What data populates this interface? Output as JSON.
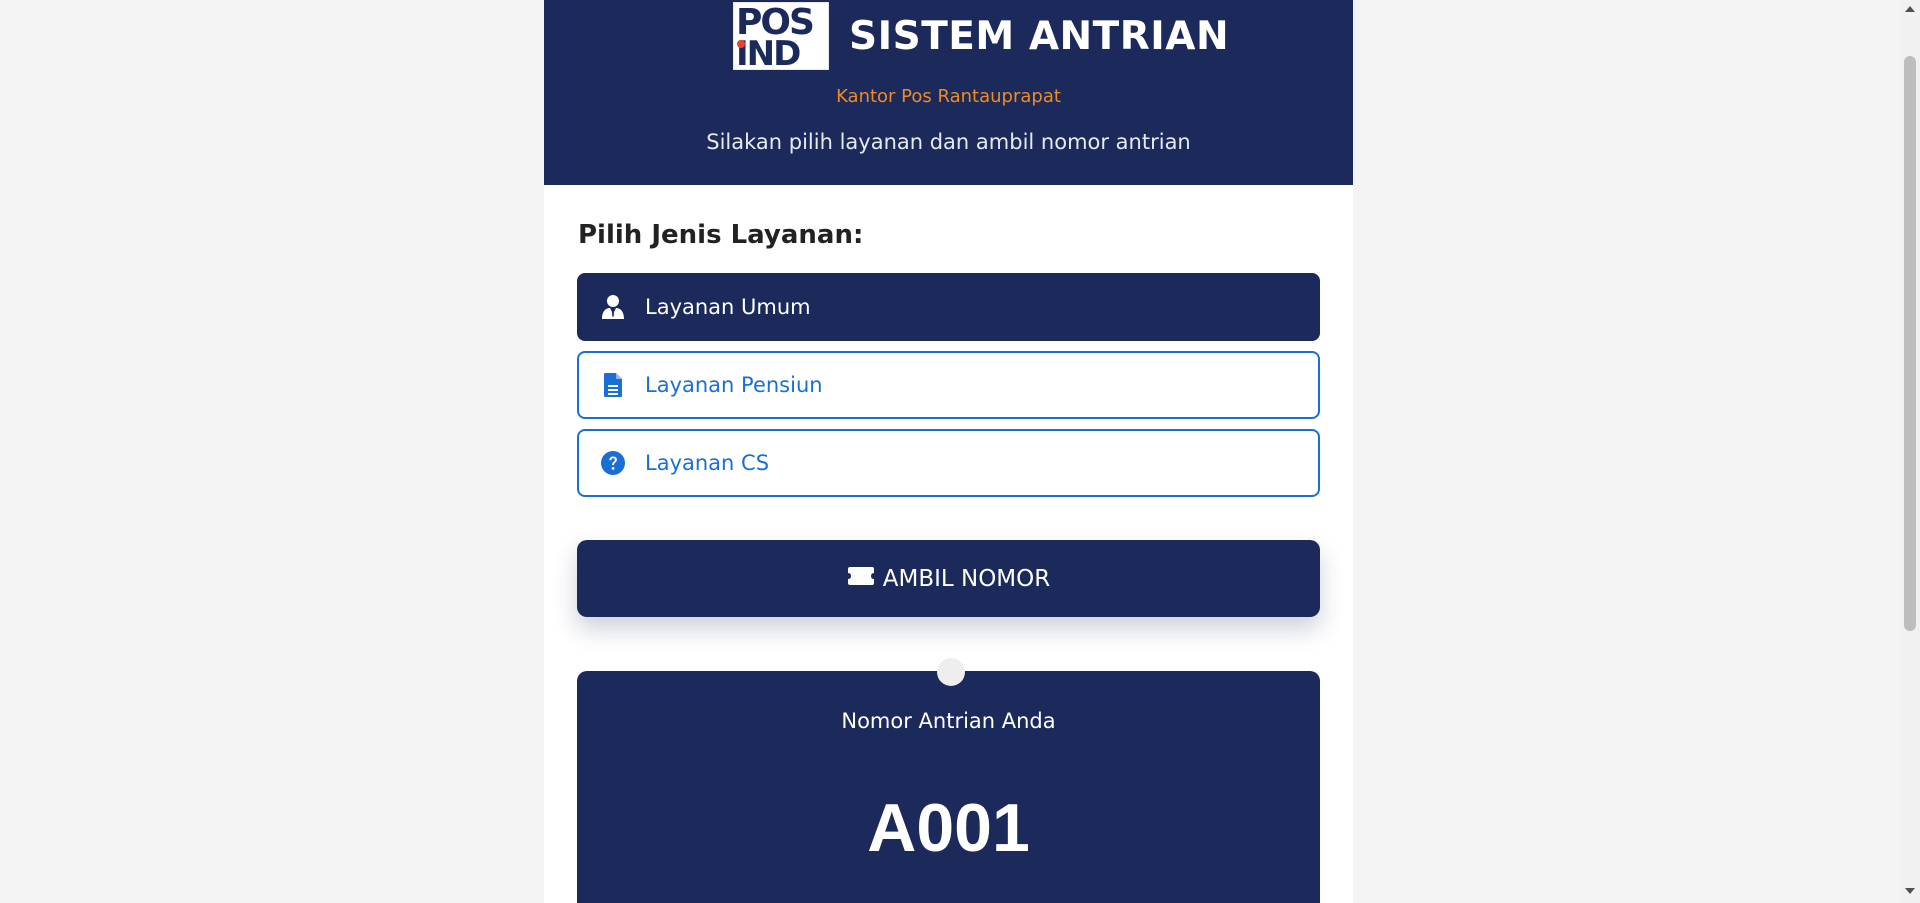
{
  "header": {
    "logo_line1": "POS",
    "logo_line2": "IND",
    "title": "SISTEM ANTRIAN",
    "office": "Kantor Pos Rantauprapat",
    "subtitle": "Silakan pilih layanan dan ambil nomor antrian"
  },
  "service_section": {
    "label": "Pilih Jenis Layanan:",
    "services": [
      {
        "label": "Layanan Umum",
        "icon": "user-tie-icon",
        "selected": true
      },
      {
        "label": "Layanan Pensiun",
        "icon": "file-document-icon",
        "selected": false
      },
      {
        "label": "Layanan CS",
        "icon": "question-circle-icon",
        "selected": false
      }
    ]
  },
  "take_button": {
    "label": "AMBIL NOMOR",
    "icon": "ticket-icon"
  },
  "ticket": {
    "label": "Nomor Antrian Anda",
    "number": "A001"
  },
  "colors": {
    "primary": "#1b2a5a",
    "accent": "#f08a24",
    "link": "#1a6fd6",
    "background": "#f4f4f4"
  }
}
